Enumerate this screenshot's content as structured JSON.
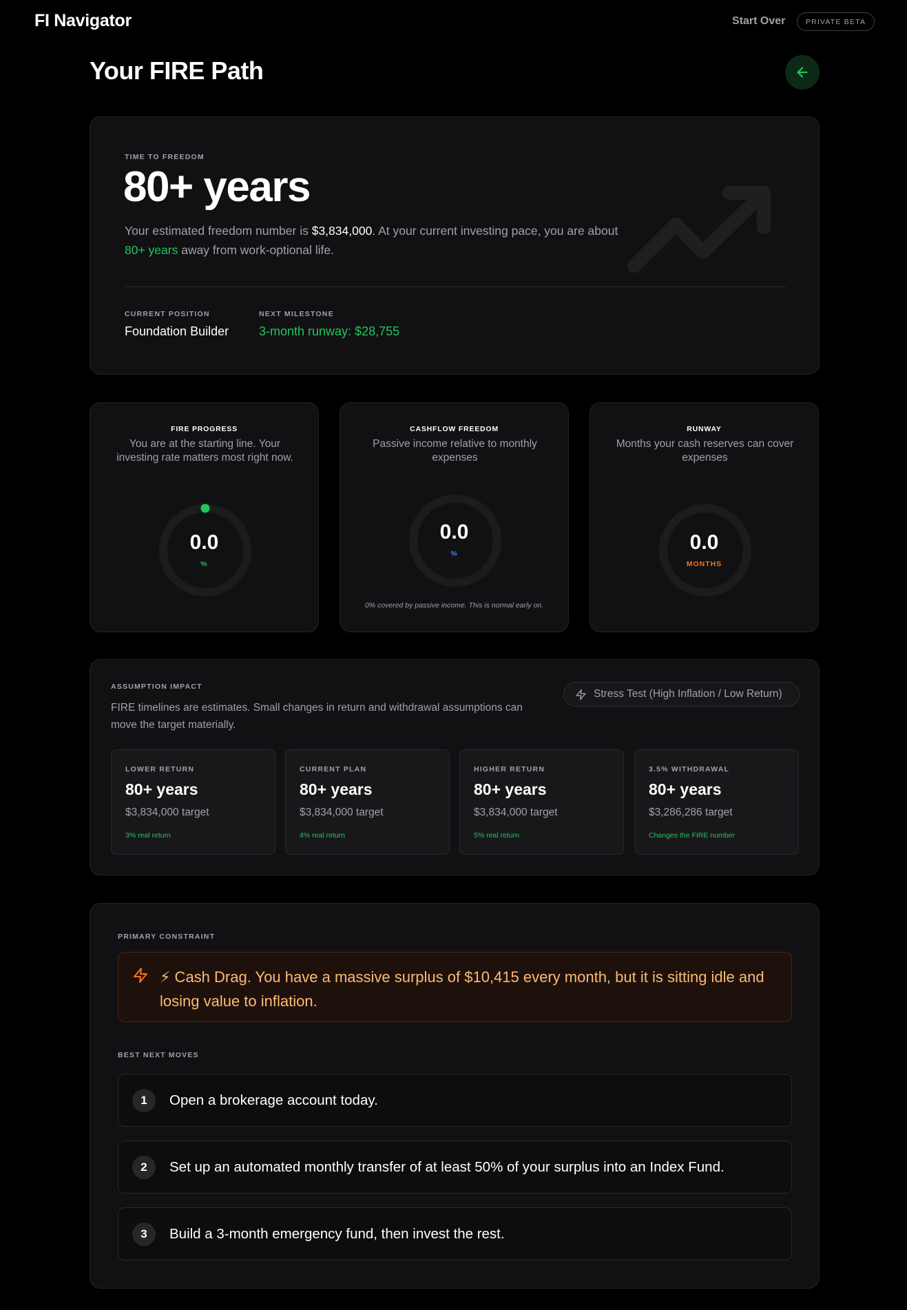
{
  "nav": {
    "brand": "FI Navigator",
    "start_over": "Start Over",
    "badge": "PRIVATE BETA"
  },
  "page": {
    "title": "Your FIRE Path"
  },
  "hero": {
    "label": "TIME TO FREEDOM",
    "years": "80+ years",
    "desc_1": "Your estimated freedom number is ",
    "freedom_number": "$3,834,000",
    "desc_2": ". At your current investing pace, you are about ",
    "years_inline": "80+ years",
    "desc_3": " away from work-optional life.",
    "position_label": "CURRENT POSITION",
    "position_value": "Foundation Builder",
    "milestone_label": "NEXT MILESTONE",
    "milestone_value": "3-month runway: $28,755"
  },
  "metrics": [
    {
      "title": "FIRE PROGRESS",
      "subtitle": "You are at the starting line. Your investing rate matters most right now.",
      "value": "0.0",
      "unit": "%",
      "progress": 0,
      "unit_color": "#22c55e"
    },
    {
      "title": "CASHFLOW FREEDOM",
      "subtitle": "Passive income relative to monthly expenses",
      "value": "0.0",
      "unit": "%",
      "progress": 0,
      "unit_color": "#3b82f6",
      "note": "0% covered by passive income. This is normal early on."
    },
    {
      "title": "RUNWAY",
      "subtitle": "Months your cash reserves can cover expenses",
      "value": "0.0",
      "unit": "MONTHS",
      "progress": 0,
      "unit_color": "#f97316"
    }
  ],
  "assumptions": {
    "label": "ASSUMPTION IMPACT",
    "desc": "FIRE timelines are estimates. Small changes in return and withdrawal assumptions can move the target materially.",
    "stress_test": "Stress Test (High Inflation / Low Return)",
    "scenarios": [
      {
        "label": "LOWER RETURN",
        "years": "80+ years",
        "target": "$3,834,000 target",
        "note": "3% real return"
      },
      {
        "label": "CURRENT PLAN",
        "years": "80+ years",
        "target": "$3,834,000 target",
        "note": "4% real return"
      },
      {
        "label": "HIGHER RETURN",
        "years": "80+ years",
        "target": "$3,834,000 target",
        "note": "5% real return"
      },
      {
        "label": "3.5% WITHDRAWAL",
        "years": "80+ years",
        "target": "$3,286,286 target",
        "note": "Changes the FIRE number"
      }
    ]
  },
  "constraint": {
    "label": "PRIMARY CONSTRAINT",
    "text": "⚡ Cash Drag. You have a massive surplus of $10,415 every month, but it is sitting idle and losing value to inflation.",
    "moves_label": "BEST NEXT MOVES",
    "moves": [
      {
        "num": "1",
        "text": "Open a brokerage account today."
      },
      {
        "num": "2",
        "text": "Set up an automated monthly transfer of at least 50% of your surplus into an Index Fund."
      },
      {
        "num": "3",
        "text": "Build a 3-month emergency fund, then invest the rest."
      }
    ]
  },
  "colors": {
    "accent_green": "#22c55e",
    "accent_blue": "#3b82f6",
    "accent_orange": "#f97316",
    "background": "#000000",
    "card": "#111113"
  }
}
